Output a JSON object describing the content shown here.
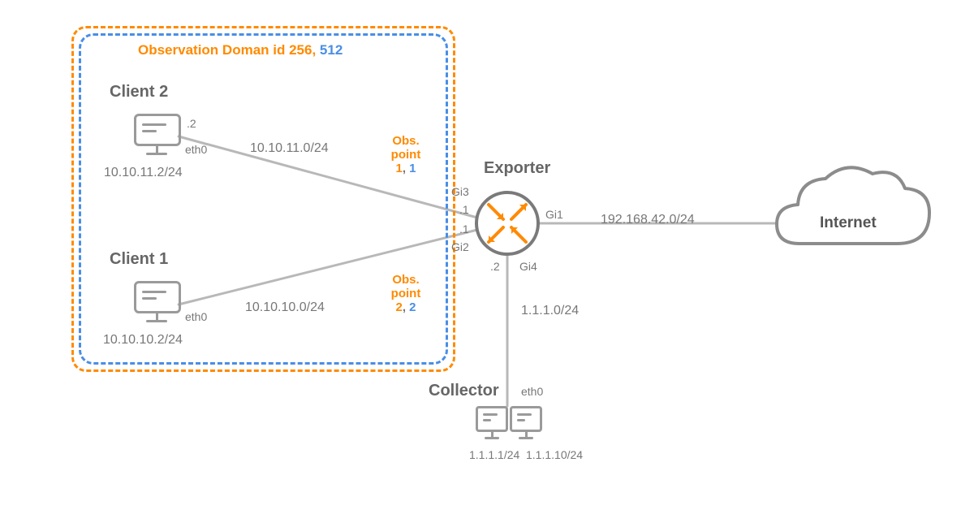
{
  "domain": {
    "label_prefix": "Observation Doman id ",
    "id_a": "256",
    "sep": ", ",
    "id_b": "512"
  },
  "client2": {
    "title": "Client 2",
    "ip": "10.10.11.2/24",
    "iface": "eth0",
    "host": ".2",
    "subnet": "10.10.11.0/24"
  },
  "client1": {
    "title": "Client 1",
    "ip": "10.10.10.2/24",
    "iface": "eth0",
    "subnet": "10.10.10.0/24"
  },
  "obs1": {
    "line1": "Obs.",
    "line2": "point",
    "a": "1",
    "sep": ", ",
    "b": "1"
  },
  "obs2": {
    "line1": "Obs.",
    "line2": "point",
    "a": "2",
    "sep": ", ",
    "b": "2"
  },
  "exporter": {
    "title": "Exporter",
    "gi1": "Gi1",
    "gi2": "Gi2",
    "gi3": "Gi3",
    "gi4": "Gi4",
    "p1": ".1",
    "p1b": ".1",
    "p2": ".2",
    "to_internet_subnet": "192.168.42.0/24"
  },
  "collector": {
    "title": "Collector",
    "iface": "eth0",
    "subnet": "1.1.1.0/24",
    "ip_a": "1.1.1.1/24",
    "ip_b": "1.1.1.10/24"
  },
  "internet": {
    "title": "Internet"
  }
}
